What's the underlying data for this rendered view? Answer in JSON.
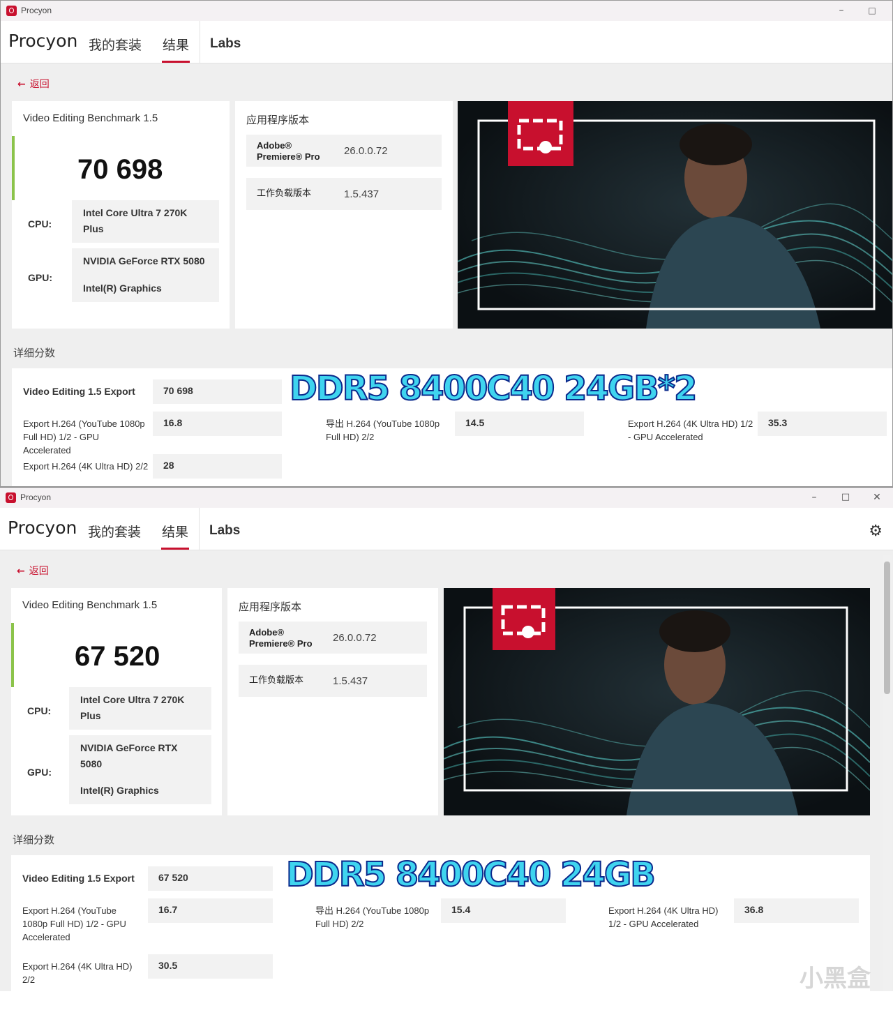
{
  "window1": {
    "title": "Procyon",
    "nav": {
      "brand": "Procyon",
      "suites": "我的套装",
      "results": "结果",
      "labs": "Labs"
    },
    "back": "返回",
    "benchmark_name": "Video Editing Benchmark 1.5",
    "score": "70 698",
    "cpu_label": "CPU:",
    "cpu": "Intel Core Ultra 7 270K Plus",
    "gpu_label": "GPU:",
    "gpu1": "NVIDIA GeForce RTX 5080",
    "gpu2": "Intel(R) Graphics",
    "app_version_title": "应用程序版本",
    "app_name_line1": "Adobe®",
    "app_name_line2": "Premiere® Pro",
    "app_version": "26.0.0.72",
    "workload_label": "工作负载版本",
    "workload_version": "1.5.437",
    "details_title": "详细分数",
    "overlay": "DDR5 8400C40 24GB*2",
    "details": {
      "main_label": "Video Editing 1.5 Export",
      "main_value": "70 698",
      "yt_gpu_label": "Export H.264 (YouTube 1080p Full HD) 1/2 - GPU Accelerated",
      "yt_gpu_value": "16.8",
      "yt_22_label": "导出 H.264 (YouTube 1080p Full HD) 2/2",
      "yt_22_value": "14.5",
      "uhd_gpu_label": "Export H.264 (4K Ultra HD) 1/2 - GPU Accelerated",
      "uhd_gpu_value": "35.3",
      "uhd_22_label": "Export H.264 (4K Ultra HD) 2/2",
      "uhd_22_value": "28"
    }
  },
  "window2": {
    "title": "Procyon",
    "nav": {
      "brand": "Procyon",
      "suites": "我的套装",
      "results": "结果",
      "labs": "Labs"
    },
    "back": "返回",
    "benchmark_name": "Video Editing Benchmark 1.5",
    "score": "67 520",
    "cpu_label": "CPU:",
    "cpu": "Intel Core Ultra 7 270K Plus",
    "gpu_label": "GPU:",
    "gpu1": "NVIDIA GeForce RTX 5080",
    "gpu2": "Intel(R) Graphics",
    "app_version_title": "应用程序版本",
    "app_name_line1": "Adobe®",
    "app_name_line2": "Premiere® Pro",
    "app_version": "26.0.0.72",
    "workload_label": "工作负载版本",
    "workload_version": "1.5.437",
    "details_title": "详细分数",
    "overlay": "DDR5 8400C40 24GB",
    "details": {
      "main_label": "Video Editing 1.5 Export",
      "main_value": "67 520",
      "yt_gpu_label": "Export H.264 (YouTube 1080p Full HD) 1/2 - GPU Accelerated",
      "yt_gpu_value": "16.7",
      "yt_22_label": "导出 H.264 (YouTube 1080p Full HD) 2/2",
      "yt_22_value": "15.4",
      "uhd_gpu_label": "Export H.264 (4K Ultra HD) 1/2 - GPU Accelerated",
      "uhd_gpu_value": "36.8",
      "uhd_22_label": "Export H.264 (4K Ultra HD) 2/2",
      "uhd_22_value": "30.5"
    }
  },
  "watermark": "小黑盒",
  "colors": {
    "accent": "#c8102e",
    "score_bar": "#8bc34a",
    "overlay_text": "#3fd4ef"
  },
  "icons": [
    "app-logo-icon",
    "back-arrow-icon",
    "minimize-icon",
    "maximize-icon",
    "close-icon",
    "gear-icon",
    "video-editing-icon"
  ]
}
